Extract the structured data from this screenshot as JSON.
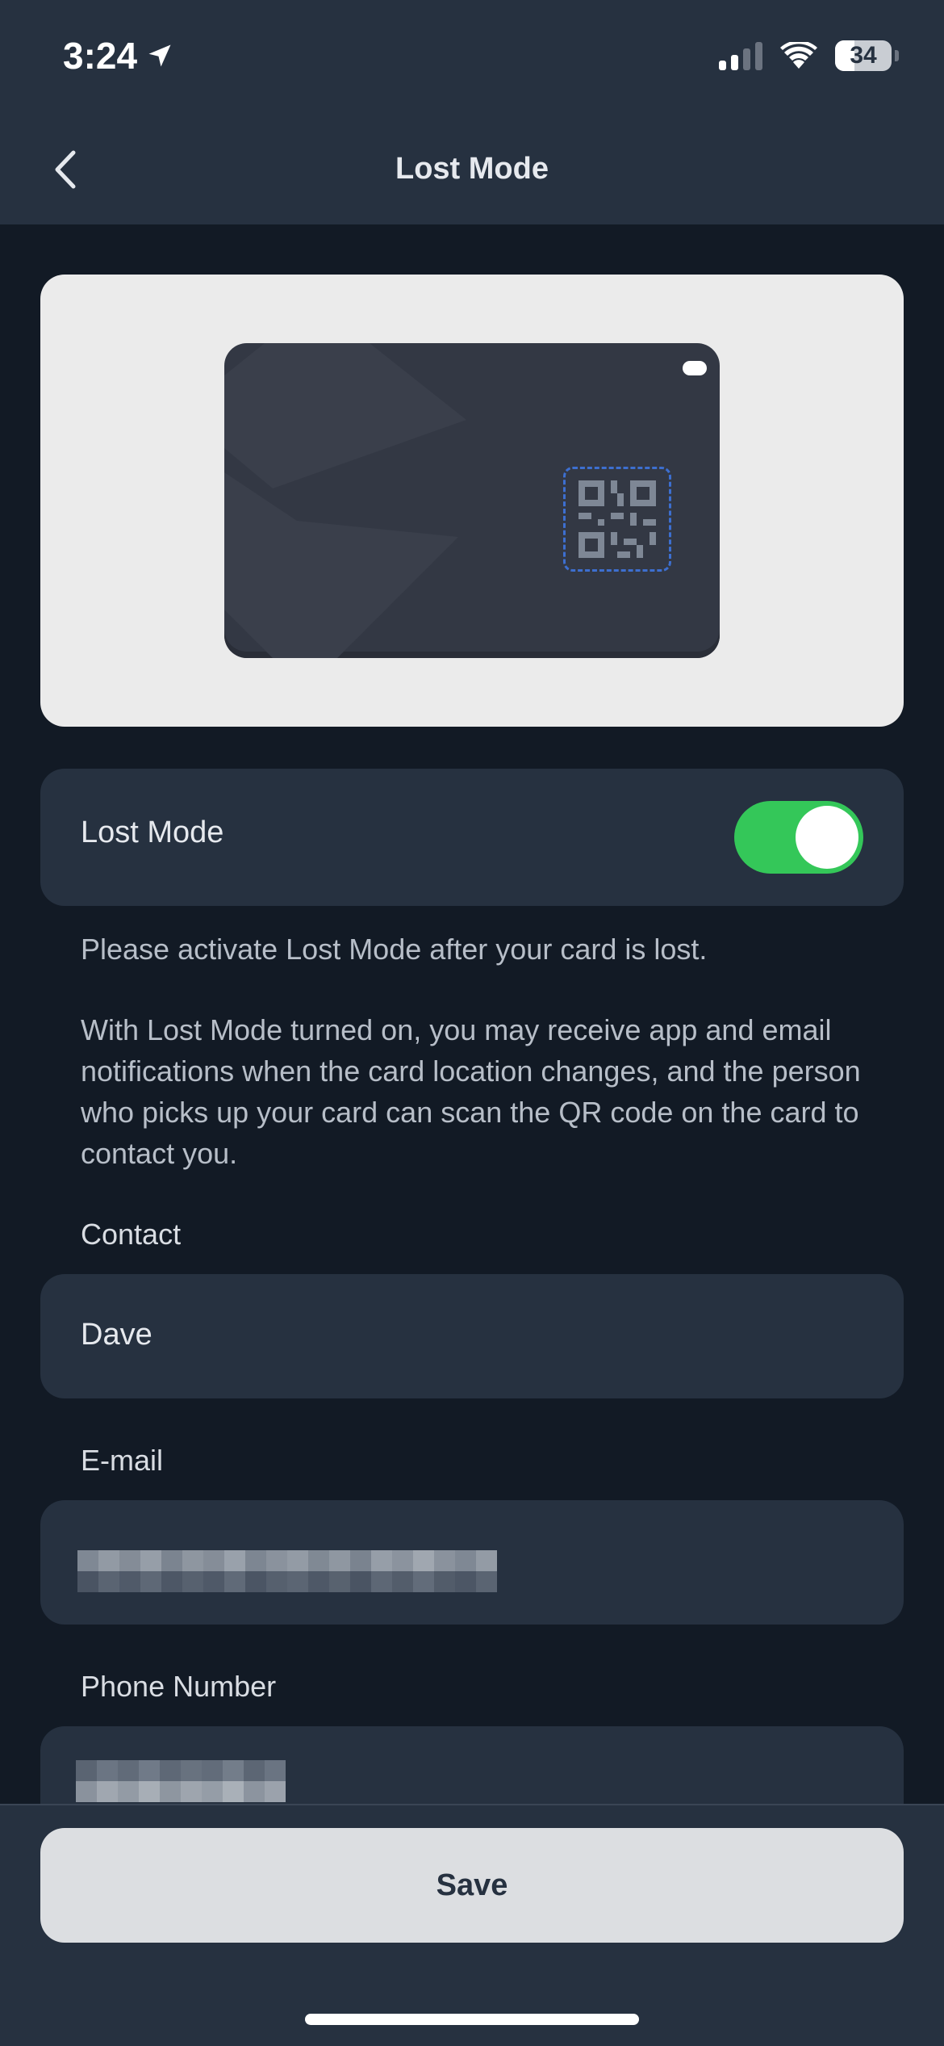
{
  "status_bar": {
    "time": "3:24",
    "battery": "34"
  },
  "nav": {
    "title": "Lost Mode"
  },
  "lost_mode": {
    "label": "Lost Mode",
    "enabled": true
  },
  "description": {
    "line1": "Please activate Lost Mode after your card is lost.",
    "line2": "With Lost Mode turned on, you may receive app and email notifications when the card location changes, and the person who picks up your card can scan the QR code on the card to contact you."
  },
  "form": {
    "contact_label": "Contact",
    "contact_value": "Dave",
    "email_label": "E-mail",
    "phone_label": "Phone Number"
  },
  "actions": {
    "save_label": "Save"
  },
  "colors": {
    "accent_green": "#34c759",
    "panel": "#263140",
    "background": "#121a25"
  }
}
